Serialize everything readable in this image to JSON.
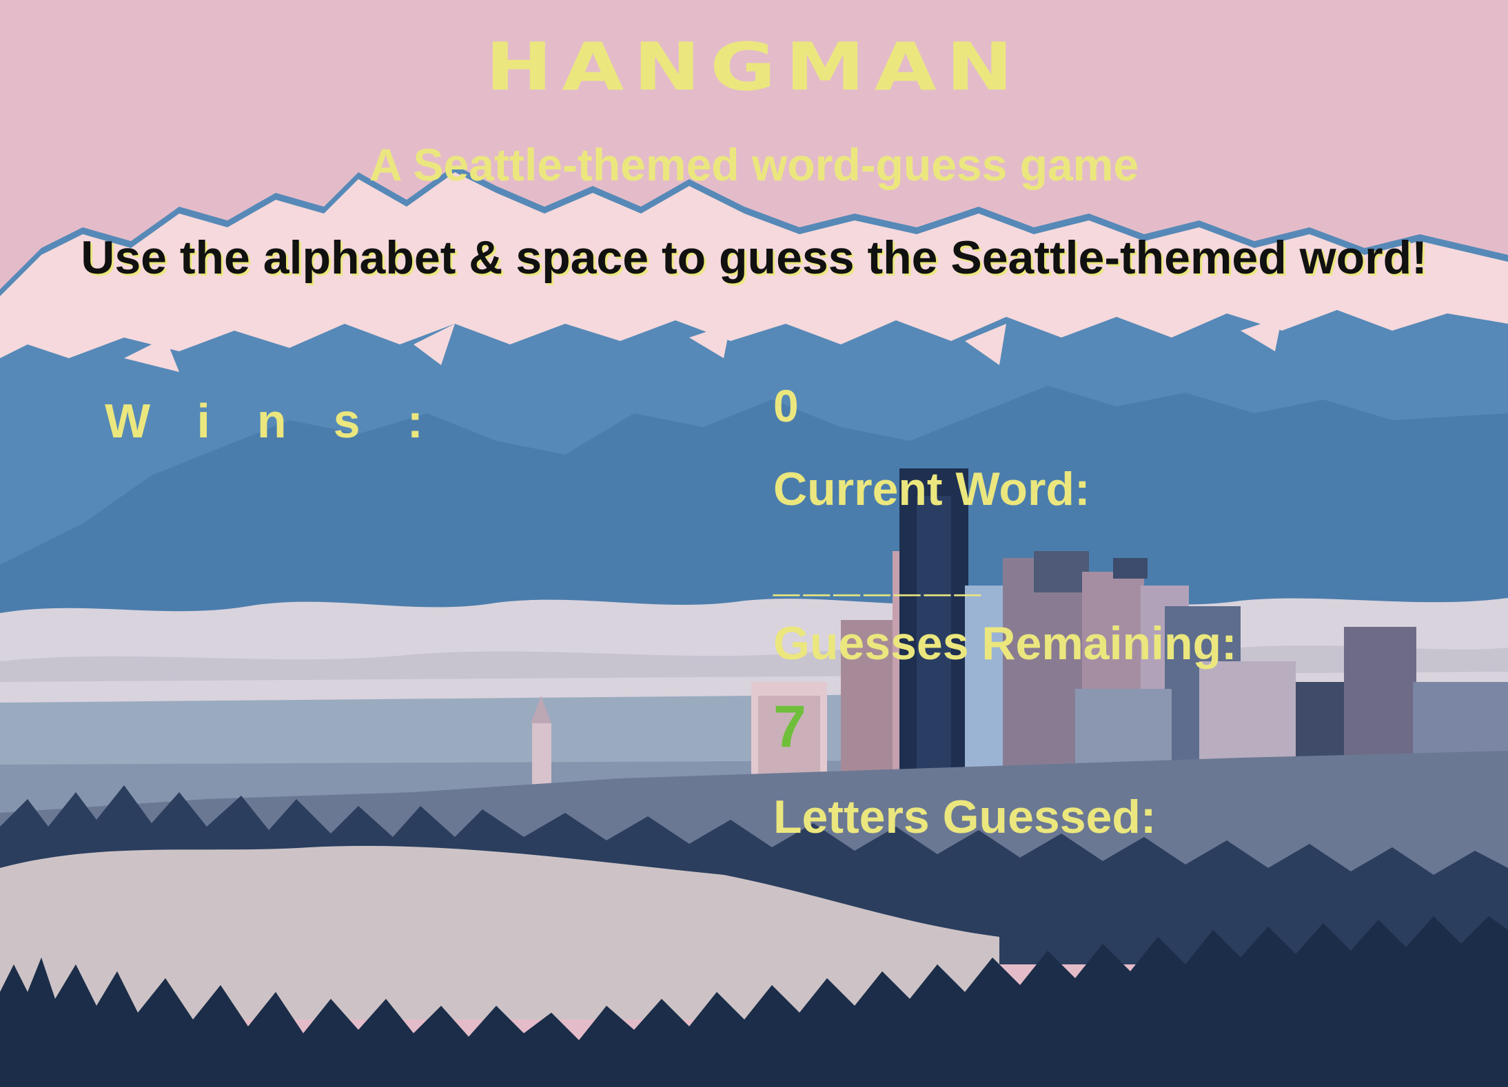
{
  "header": {
    "title": "HANGMAN",
    "subtitle": "A Seattle-themed word-guess game",
    "instructions": "Use the alphabet & space to guess the Seattle-themed word!"
  },
  "scoreboard": {
    "wins_label": "Wins:",
    "wins_value": "0",
    "current_word_label": "Current Word:",
    "current_word": "_______",
    "guesses_remaining_label": "Guesses Remaining:",
    "guesses_remaining_value": "7",
    "letters_guessed_label": "Letters Guessed:",
    "letters_guessed_value": ""
  },
  "colors": {
    "sky": "#e4bcc9",
    "text_accent": "#ebe77e",
    "guesses_value": "#6fbf3a",
    "instructions_text": "#111111",
    "mountains_far": "#5689b7",
    "snow": "#f6d9dc",
    "fog": "#d9d3dd",
    "trees": "#1b2d48"
  }
}
